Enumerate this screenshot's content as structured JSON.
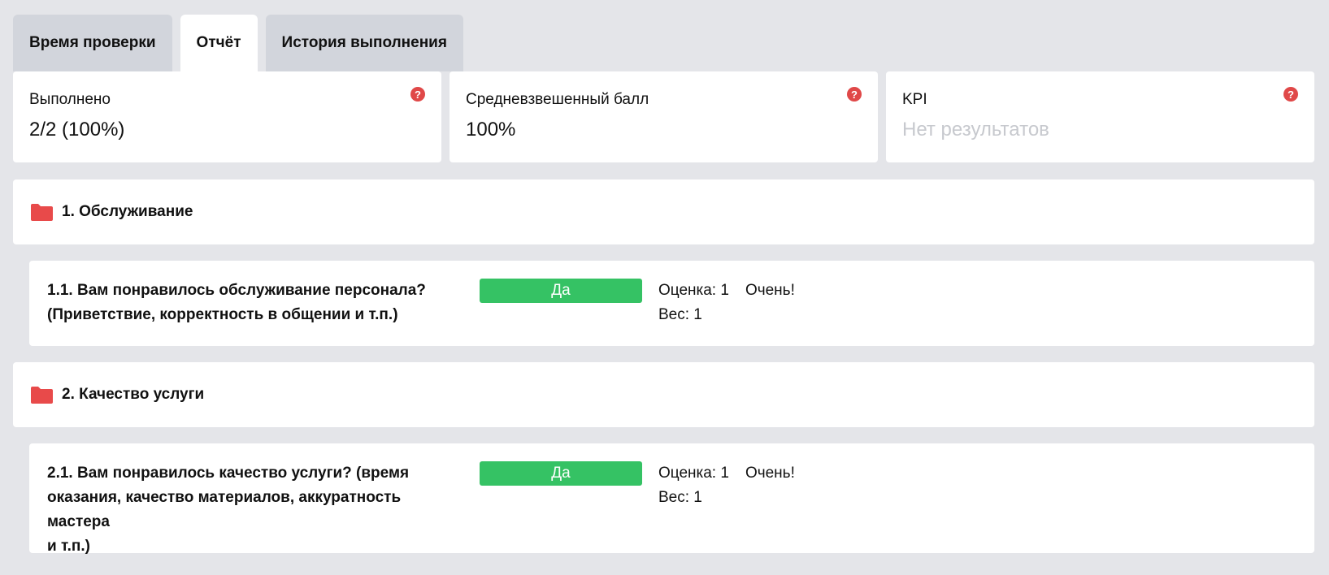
{
  "tabs": [
    {
      "label": "Время проверки",
      "active": false
    },
    {
      "label": "Отчёт",
      "active": true
    },
    {
      "label": "История выполнения",
      "active": false
    }
  ],
  "stats": [
    {
      "label": "Выполнено",
      "value": "2/2 (100%)",
      "help_icon": "question-icon"
    },
    {
      "label": "Средневзвешенный балл",
      "value": "100%",
      "help_icon": "question-icon"
    },
    {
      "label": "KPI",
      "value": "Нет результатов",
      "help_icon": "question-icon"
    }
  ],
  "sections": [
    {
      "icon": "folder-icon",
      "title": "1. Обслуживание",
      "questions": [
        {
          "text_line1": "1.1. Вам понравилось обслуживание персонала?",
          "text_line2": "(Приветствие, корректность в общении и т.п.)",
          "answer": "Да",
          "score_label": "Оценка: 1",
          "score_comment": "Очень!",
          "weight_label": "Вес: 1"
        }
      ]
    },
    {
      "icon": "folder-icon",
      "title": "2. Качество услуги",
      "questions": [
        {
          "text_line1": "2.1. Вам понравилось качество услуги? (время",
          "text_line2": "оказания, качество материалов, аккуратность мастера",
          "text_line3": "и т.п.)",
          "answer": "Да",
          "score_label": "Оценка: 1",
          "score_comment": "Очень!",
          "weight_label": "Вес: 1"
        }
      ]
    }
  ],
  "colors": {
    "background": "#e4e5e9",
    "tab_inactive": "#d2d5dc",
    "card": "#ffffff",
    "accent_red": "#e04848",
    "answer_green": "#35c264",
    "placeholder_text": "#c7c9ce"
  }
}
